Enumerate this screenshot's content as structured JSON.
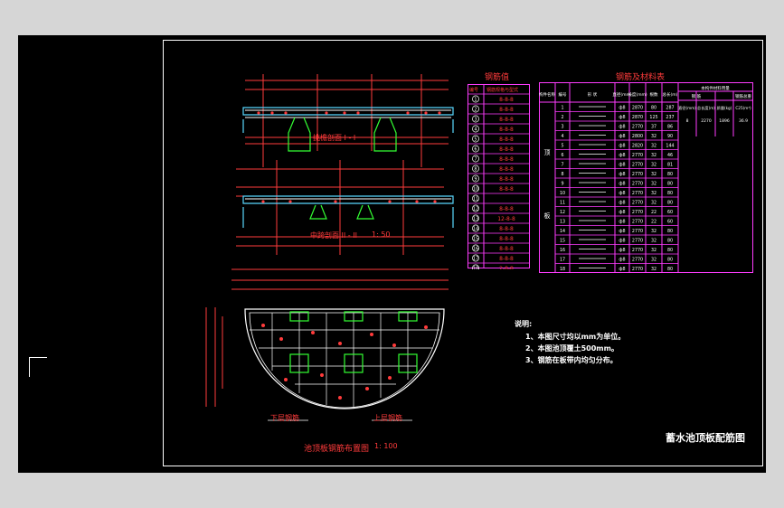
{
  "drawing": {
    "title": "蓄水池顶板配筋图",
    "section_1_label": "挑檐剖面 I - I",
    "section_2_label": "中跨剖面 II - II",
    "section_2_scale": "1: 50",
    "plan_label": "池顶板钢筋布置图",
    "plan_scale": "1: 100",
    "lower_rebar_label": "下层钢筋",
    "upper_rebar_label": "上层钢筋"
  },
  "notes": {
    "title": "说明:",
    "items": [
      "1、本图尺寸均以mm为单位。",
      "2、本图池顶覆土500mm。",
      "3、钢筋在板带内均匀分布。"
    ]
  },
  "table_left": {
    "title": "钢筋值",
    "headers": [
      "编号",
      "钢筋规格与型式"
    ],
    "rows": [
      [
        "1",
        "8-8-8"
      ],
      [
        "2",
        "8-8-8"
      ],
      [
        "3",
        "8-8-8"
      ],
      [
        "4",
        "8-8-8"
      ],
      [
        "5",
        "8-8-8"
      ],
      [
        "6",
        "8-8-8"
      ],
      [
        "7",
        "8-8-8"
      ],
      [
        "8",
        "8-8-8"
      ],
      [
        "9",
        "8-8-8"
      ],
      [
        "10",
        "8-8-8"
      ],
      [
        "11",
        ""
      ],
      [
        "12",
        "8-8-8"
      ],
      [
        "13",
        "12-8-8"
      ],
      [
        "14",
        "8-8-8"
      ],
      [
        "15",
        "8-8-8"
      ],
      [
        "16",
        "8-8-8"
      ],
      [
        "17",
        "8-8-8"
      ],
      [
        "18",
        "2-8-8"
      ]
    ]
  },
  "table_right": {
    "title": "钢筋及材料表",
    "headers": [
      "构件名称",
      "编号",
      "形 状",
      "直径(mm)",
      "长度(mm)",
      "根数",
      "总长(m)",
      "本构件材料用量"
    ],
    "sub_headers": [
      "钢 筋",
      "钢筋总重"
    ],
    "material_headers": [
      "直径(mm)",
      "总长度(m)",
      "质量(kg)",
      "C25(m³)"
    ],
    "material_values": [
      "8",
      "2270",
      "1896",
      "36.9"
    ],
    "member_names": [
      "顶",
      "板"
    ],
    "rows": [
      [
        "1",
        "",
        "ф8",
        "2870",
        "80",
        "287"
      ],
      [
        "2",
        "",
        "ф8",
        "2870",
        "125",
        "237"
      ],
      [
        "3",
        "",
        "ф8",
        "2770",
        "37",
        "86"
      ],
      [
        "4",
        "",
        "ф8",
        "2800",
        "32",
        "90"
      ],
      [
        "5",
        "",
        "ф8",
        "2820",
        "32",
        "144"
      ],
      [
        "6",
        "",
        "ф8",
        "2770",
        "32",
        "46"
      ],
      [
        "7",
        "",
        "ф8",
        "2770",
        "32",
        "81"
      ],
      [
        "8",
        "",
        "ф8",
        "2770",
        "32",
        "80"
      ],
      [
        "9",
        "",
        "ф8",
        "2770",
        "32",
        "80"
      ],
      [
        "10",
        "",
        "ф8",
        "2770",
        "32",
        "80"
      ],
      [
        "11",
        "",
        "ф8",
        "2770",
        "32",
        "80"
      ],
      [
        "12",
        "",
        "ф8",
        "2770",
        "22",
        "60"
      ],
      [
        "13",
        "",
        "ф8",
        "2770",
        "22",
        "60"
      ],
      [
        "14",
        "",
        "ф8",
        "2770",
        "32",
        "80"
      ],
      [
        "15",
        "",
        "ф8",
        "2770",
        "32",
        "80"
      ],
      [
        "16",
        "",
        "ф8",
        "2770",
        "32",
        "80"
      ],
      [
        "17",
        "",
        "ф8",
        "2770",
        "32",
        "80"
      ],
      [
        "18",
        "",
        "ф8",
        "2770",
        "32",
        "80"
      ]
    ]
  }
}
